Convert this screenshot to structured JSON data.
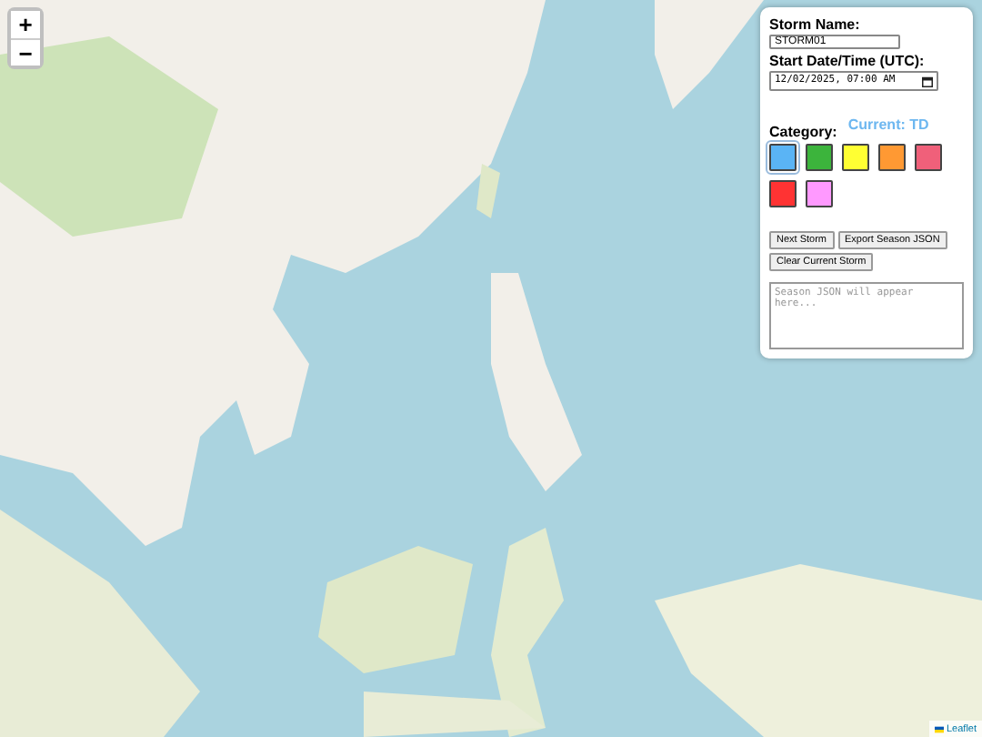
{
  "zoom": {
    "in": "+",
    "out": "−"
  },
  "panel": {
    "name_label": "Storm Name:",
    "name_value": "STORM01",
    "date_label": "Start Date/Time (UTC):",
    "date_value": "12/02/2025, 07:00 AM",
    "category_label": "Category:",
    "current": "Current: TD",
    "categories": [
      {
        "color": "#5ab4f5",
        "selected": true
      },
      {
        "color": "#3cb43c",
        "selected": false
      },
      {
        "color": "#ffff33",
        "selected": false
      },
      {
        "color": "#ff9933",
        "selected": false
      },
      {
        "color": "#f0607a",
        "selected": false
      },
      {
        "color": "#ff3333",
        "selected": false
      },
      {
        "color": "#ff99ff",
        "selected": false
      }
    ],
    "buttons": [
      "Next Storm",
      "Export Season JSON",
      "Clear Current Storm"
    ],
    "json_placeholder": "Season JSON will appear here..."
  },
  "attribution": "Leaflet"
}
